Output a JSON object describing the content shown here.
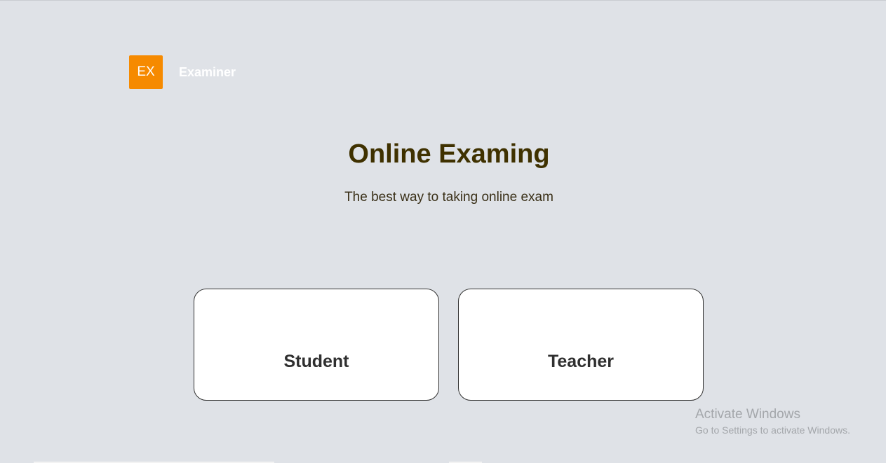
{
  "brand": {
    "logo_text": "EX",
    "name": "Examiner",
    "logo_color": "#f68a00"
  },
  "hero": {
    "title": "Online Examing",
    "subtitle": "The best way to taking online exam"
  },
  "roles": [
    {
      "label": "Student"
    },
    {
      "label": "Teacher"
    }
  ],
  "watermark": {
    "title": "Activate Windows",
    "subtitle": "Go to Settings to activate Windows."
  },
  "colors": {
    "background": "#dfe2e7",
    "title": "#3f3100",
    "card": "#ffffff"
  }
}
